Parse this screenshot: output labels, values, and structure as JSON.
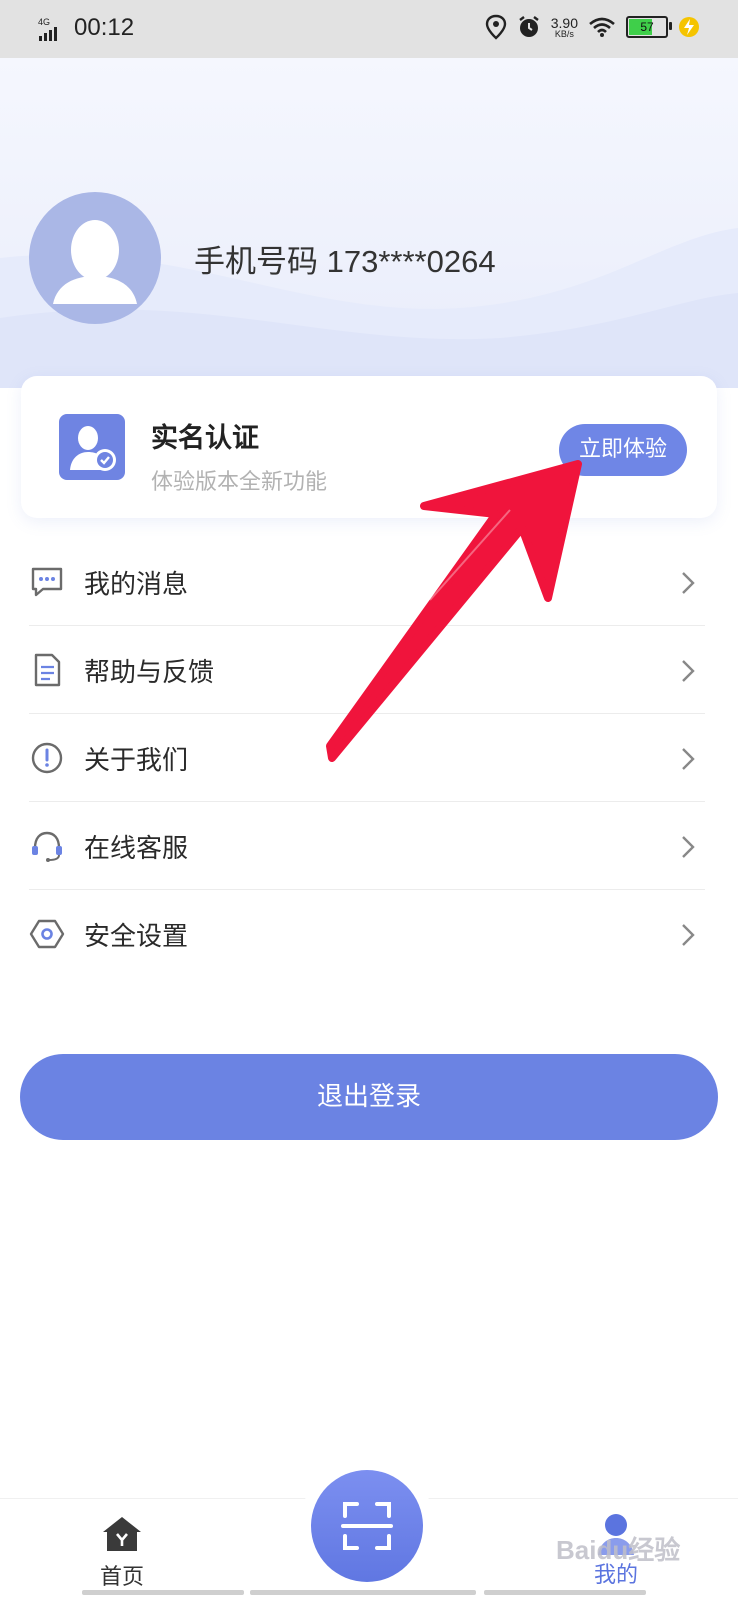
{
  "status_bar": {
    "network": "4G",
    "time": "00:12",
    "speed_value": "3.90",
    "speed_unit": "KB/s",
    "battery": "57"
  },
  "profile": {
    "phone_label": "手机号码 173****0264"
  },
  "verify_card": {
    "title": "实名认证",
    "subtitle": "体验版本全新功能",
    "button_label": "立即体验"
  },
  "menu": {
    "items": [
      {
        "label": "我的消息",
        "icon": "message-icon"
      },
      {
        "label": "帮助与反馈",
        "icon": "document-icon"
      },
      {
        "label": "关于我们",
        "icon": "info-icon"
      },
      {
        "label": "在线客服",
        "icon": "headset-icon"
      },
      {
        "label": "安全设置",
        "icon": "hexagon-settings-icon"
      }
    ]
  },
  "logout_label": "退出登录",
  "tabbar": {
    "home_label": "首页",
    "mine_label": "我的"
  },
  "watermark": "Baidu经验",
  "colors": {
    "accent": "#6b83e3",
    "arrow": "#f0143c"
  }
}
